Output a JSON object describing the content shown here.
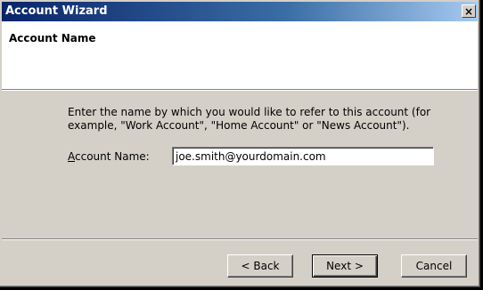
{
  "window": {
    "title": "Account Wizard",
    "close_label": "×"
  },
  "header": {
    "title": "Account Name"
  },
  "main": {
    "description": "Enter the name by which you would like to refer to this account (for example, \"Work Account\", \"Home Account\" or \"News Account\").",
    "field": {
      "label_accesskey": "A",
      "label_rest": "ccount Name:",
      "value": "joe.smith@yourdomain.com"
    }
  },
  "buttons": {
    "back": "< Back",
    "next": "Next >",
    "cancel": "Cancel"
  }
}
